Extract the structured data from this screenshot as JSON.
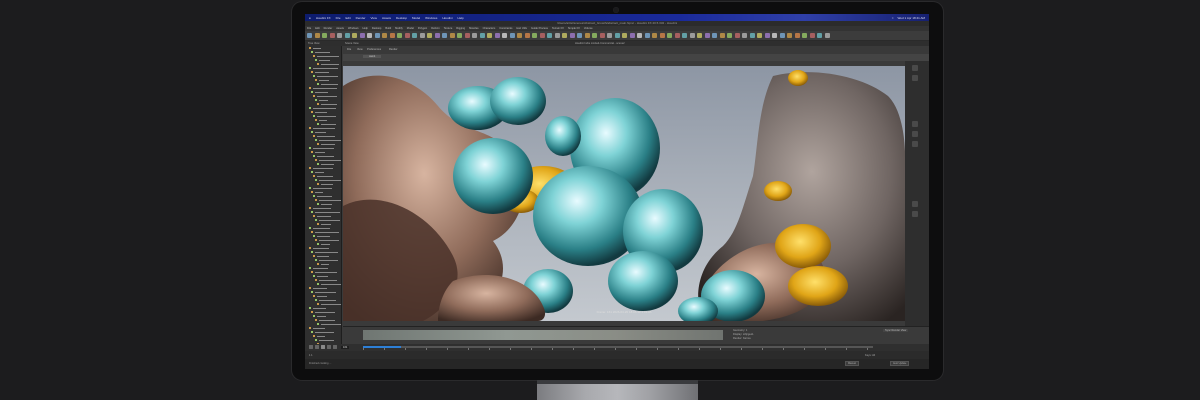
{
  "menubar": {
    "items": [
      "Houdini FX",
      "File",
      "Edit",
      "Render",
      "View",
      "Assets",
      "Desktop",
      "Model",
      "Windows",
      "Houdini",
      "Help"
    ],
    "clock": "Wed 1 Apr 18:41 AM"
  },
  "window": {
    "title": "/Users/artist/scenes/Abstract_Growth/abstract_main.hipnc - Houdini FX 20.5.332 - Houdini"
  },
  "app_menu": [
    "File",
    "Edit",
    "Render",
    "Assets",
    "Windows",
    "Help",
    "Desktop",
    "Build",
    "Modify",
    "Model",
    "Polygon",
    "Deform",
    "Texture",
    "Rigging",
    "Muscles",
    "Characters",
    "Constraints",
    "Hair Utils",
    "Guide Process",
    "Terrain FX",
    "Simple FX",
    "Volume"
  ],
  "tabs": {
    "tree": "Tree View",
    "viewport": "Scene View",
    "render_label": "Houdini Indie Limited-Commercial - scene2"
  },
  "viewport": {
    "header": [
      "File",
      "View",
      "Preferences",
      "Render"
    ],
    "camera": "cam1",
    "caption": "Frame: 161  2026-03-26 18:05:33  1:31:05"
  },
  "timeline": {
    "lines": [
      "Geometry: 1",
      "Display: /obj/geo1",
      "Render: Karma",
      "Snapshots: 1"
    ],
    "status_right": "Sync Render View"
  },
  "playbar": {
    "frame": "161",
    "start": "1",
    "end": "240"
  },
  "bottom": {
    "left": "1   1",
    "right_a": "Keys: All",
    "right_b": "Auto Update"
  },
  "status": {
    "message": "Finished cooking ...",
    "btn_a": "Manual",
    "btn_b": "Auto Update"
  },
  "colors": {
    "menubar_blue": "#1a2a9a",
    "accent_blue": "#2d7fd6",
    "chrome": "#3a3a3a"
  }
}
